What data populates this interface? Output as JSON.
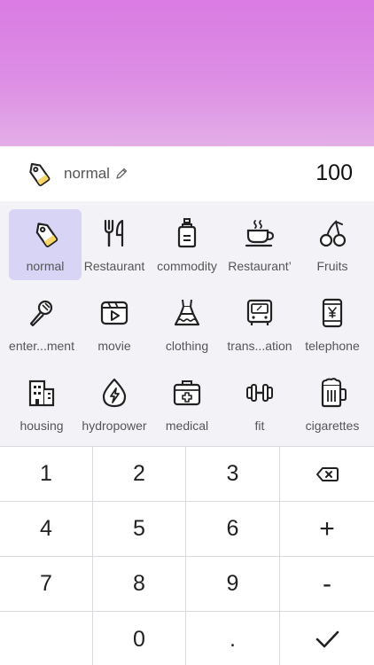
{
  "entry": {
    "category_name": "normal",
    "amount": "100"
  },
  "categories": [
    {
      "label": "normal",
      "icon": "tag-icon",
      "selected": true
    },
    {
      "label": "Restaurant",
      "icon": "fork-knife-icon"
    },
    {
      "label": "commodity",
      "icon": "bottle-icon"
    },
    {
      "label": "Restaurant’",
      "icon": "coffee-cup-icon"
    },
    {
      "label": "Fruits",
      "icon": "cherry-icon"
    },
    {
      "label": "enter...ment",
      "icon": "microphone-icon"
    },
    {
      "label": "movie",
      "icon": "video-icon"
    },
    {
      "label": "clothing",
      "icon": "dress-icon"
    },
    {
      "label": "trans...ation",
      "icon": "bus-icon"
    },
    {
      "label": "telephone",
      "icon": "phone-yen-icon"
    },
    {
      "label": "housing",
      "icon": "building-icon"
    },
    {
      "label": "hydropower",
      "icon": "drop-bolt-icon"
    },
    {
      "label": "medical",
      "icon": "medical-kit-icon"
    },
    {
      "label": "fit",
      "icon": "dumbbell-icon"
    },
    {
      "label": "cigarettes",
      "icon": "beer-mug-icon"
    }
  ],
  "keypad": {
    "k1": "1",
    "k2": "2",
    "k3": "3",
    "k4": "4",
    "k5": "5",
    "k6": "6",
    "k7": "7",
    "k8": "8",
    "k9": "9",
    "k0": "0",
    "dot": ".",
    "plus": "+",
    "minus": "-"
  },
  "colors": {
    "header_gradient_top": "#d97be3",
    "header_gradient_bottom": "#e3aee7",
    "selected_bg": "#d7d4f5",
    "panel_bg": "#f3f2f7",
    "tag_yellow": "#f7d56b"
  }
}
